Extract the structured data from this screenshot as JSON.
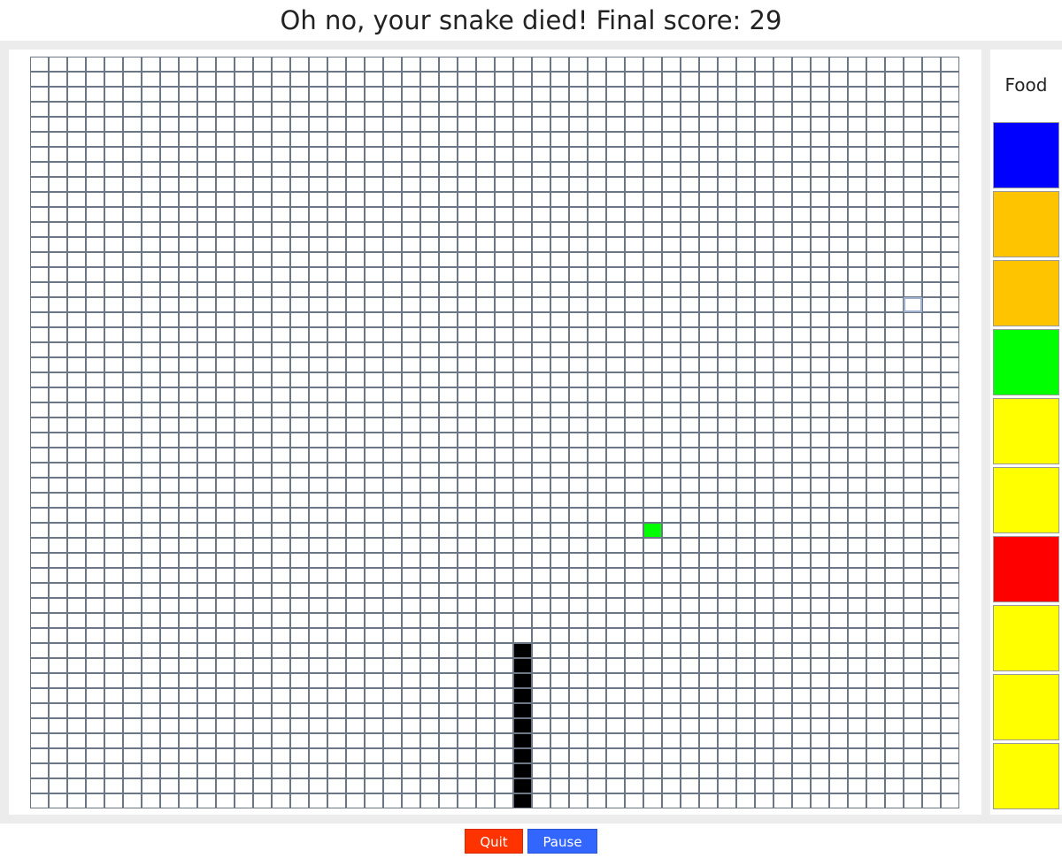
{
  "status": {
    "message": "Oh no, your snake died! Final score: 29"
  },
  "board": {
    "columns": 50,
    "rows": 50,
    "grid_line_color": "#6b7785",
    "empty_color": "#ffffff",
    "snake_color": "#000000",
    "food_color": "#00ff00",
    "snake_cells": [
      [
        26,
        39
      ],
      [
        26,
        40
      ],
      [
        26,
        41
      ],
      [
        26,
        42
      ],
      [
        26,
        43
      ],
      [
        26,
        44
      ],
      [
        26,
        45
      ],
      [
        26,
        46
      ],
      [
        26,
        47
      ],
      [
        26,
        48
      ],
      [
        26,
        49
      ]
    ],
    "food_cell": [
      33,
      31
    ],
    "highlight_cell": [
      47,
      16
    ],
    "highlight_border": "#9fb0d0"
  },
  "food_panel": {
    "title": "Food",
    "queue": [
      {
        "name": "blue",
        "color": "#0000ff"
      },
      {
        "name": "orange",
        "color": "#ffc400"
      },
      {
        "name": "orange",
        "color": "#ffc400"
      },
      {
        "name": "green",
        "color": "#00ff00"
      },
      {
        "name": "yellow",
        "color": "#ffff00"
      },
      {
        "name": "yellow",
        "color": "#ffff00"
      },
      {
        "name": "red",
        "color": "#ff0000"
      },
      {
        "name": "yellow",
        "color": "#ffff00"
      },
      {
        "name": "yellow",
        "color": "#ffff00"
      },
      {
        "name": "yellow",
        "color": "#ffff00"
      }
    ]
  },
  "controls": {
    "quit_label": "Quit",
    "quit_color": "#ff3300",
    "pause_label": "Pause",
    "pause_color": "#3366ff"
  }
}
